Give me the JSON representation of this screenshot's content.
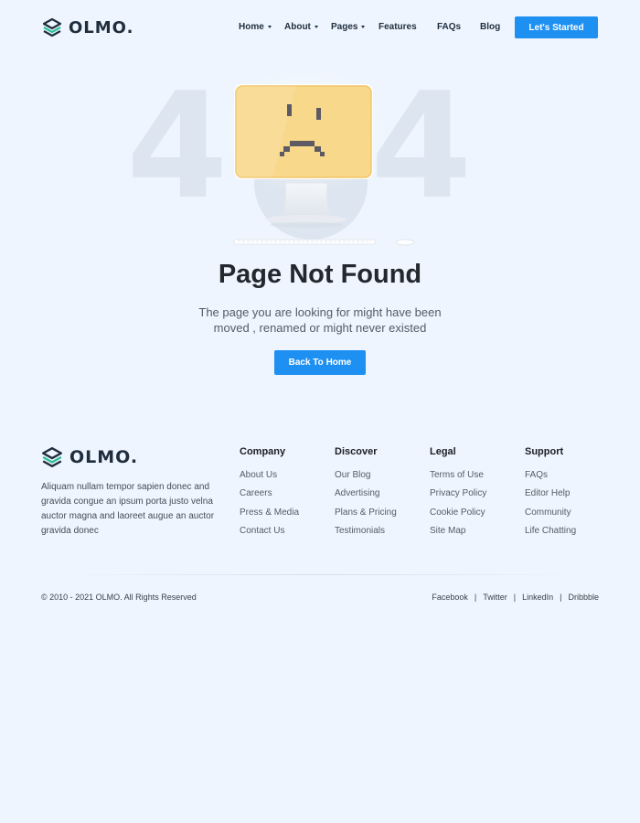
{
  "brand": {
    "name": "OLMO."
  },
  "nav": {
    "items": [
      {
        "label": "Home",
        "dropdown": true
      },
      {
        "label": "About",
        "dropdown": true
      },
      {
        "label": "Pages",
        "dropdown": true
      },
      {
        "label": "Features",
        "dropdown": false
      },
      {
        "label": "FAQs",
        "dropdown": false
      },
      {
        "label": "Blog",
        "dropdown": false
      }
    ],
    "cta": "Let's Started"
  },
  "hero": {
    "digit_left": "4",
    "digit_right": "4",
    "title": "Page Not Found",
    "subtitle": "The page you are looking for might have been moved , renamed or might never existed",
    "button": "Back To Home"
  },
  "footer": {
    "about": "Aliquam nullam tempor sapien donec and gravida congue an ipsum porta justo velna auctor magna and laoreet augue an auctor gravida donec",
    "columns": [
      {
        "title": "Company",
        "links": [
          "About Us",
          "Careers",
          "Press & Media",
          "Contact Us"
        ]
      },
      {
        "title": "Discover",
        "links": [
          "Our Blog",
          "Advertising",
          "Plans & Pricing",
          "Testimonials"
        ]
      },
      {
        "title": "Legal",
        "links": [
          "Terms of Use",
          "Privacy Policy",
          "Cookie Policy",
          "Site Map"
        ]
      },
      {
        "title": "Support",
        "links": [
          "FAQs",
          "Editor Help",
          "Community",
          "Life Chatting"
        ]
      }
    ],
    "copyright": "© 2010 - 2021 OLMO. All Rights Reserved",
    "social": [
      "Facebook",
      "Twitter",
      "LinkedIn",
      "Dribbble"
    ]
  },
  "colors": {
    "background": "#eef5fe",
    "accent": "#1e90f2",
    "logo_teal": "#2bbf9a",
    "logo_dark": "#1f2d3d",
    "screen": "#f8d88a"
  },
  "icons": {
    "logo": "layers-icon",
    "illustration": "sad-monitor-icon"
  }
}
